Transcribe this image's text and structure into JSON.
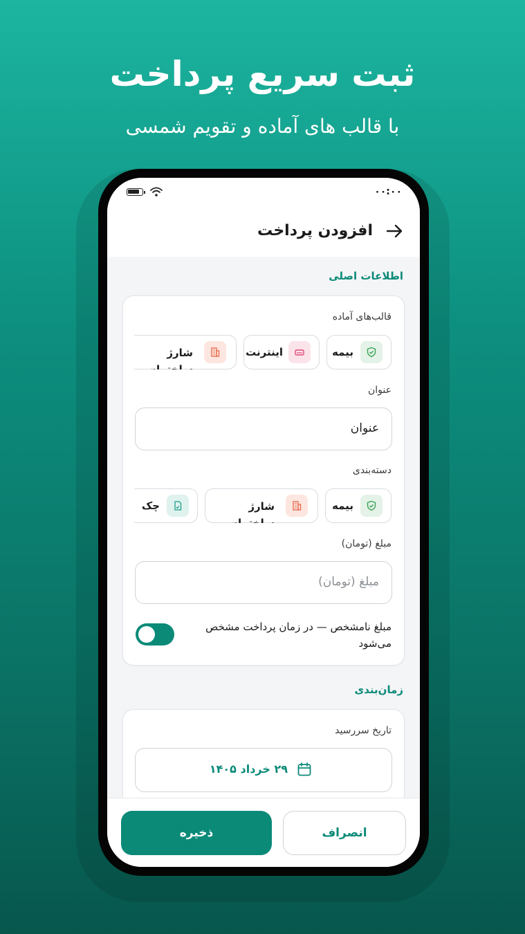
{
  "hero": {
    "title": "ثبت سریع پرداخت",
    "subtitle": "با قالب های آماده و تقویم شمسی"
  },
  "status_bar": {
    "time": "۰۰:۰۰",
    "battery_icon": "battery-icon",
    "wifi_icon": "wifi-icon"
  },
  "header": {
    "title": "افزودن پرداخت",
    "back_icon": "arrow-right-icon"
  },
  "sections": {
    "main_info": "اطلاعات اصلی",
    "scheduling": "زمان‌بندی"
  },
  "templates": {
    "label": "قالب‌های آماده",
    "items": [
      {
        "label": "بیمه",
        "icon": "shield-icon",
        "color": "#3aa356"
      },
      {
        "label": "اینترنت",
        "icon": "router-icon",
        "color": "#e04a7a"
      },
      {
        "label": "شارژ ساختمان",
        "icon": "building-icon",
        "color": "#e8664a"
      }
    ]
  },
  "title_field": {
    "label": "عنوان",
    "value": "عنوان"
  },
  "category": {
    "label": "دسته‌بندی",
    "items": [
      {
        "label": "بیمه",
        "icon": "shield-icon",
        "color": "#3aa356"
      },
      {
        "label": "شارژ ساختمان",
        "icon": "building-icon",
        "color": "#e8664a"
      },
      {
        "label": "چک",
        "icon": "cheque-icon",
        "color": "#1f9e8a"
      }
    ]
  },
  "amount_field": {
    "label": "مبلغ (تومان)",
    "placeholder": "مبلغ (تومان)"
  },
  "unknown_amount": {
    "text": "مبلغ نامشخص — در زمان پرداخت مشخص می‌شود",
    "enabled": true
  },
  "due_date": {
    "label": "تاریخ سررسید",
    "value": "۲۹ خرداد ۱۴۰۵",
    "icon": "calendar-icon"
  },
  "actions": {
    "cancel": "انصراف",
    "save": "ذخیره"
  },
  "colors": {
    "accent": "#0b8a78",
    "background_top": "#1cb5a0",
    "background_bottom": "#07574d"
  }
}
